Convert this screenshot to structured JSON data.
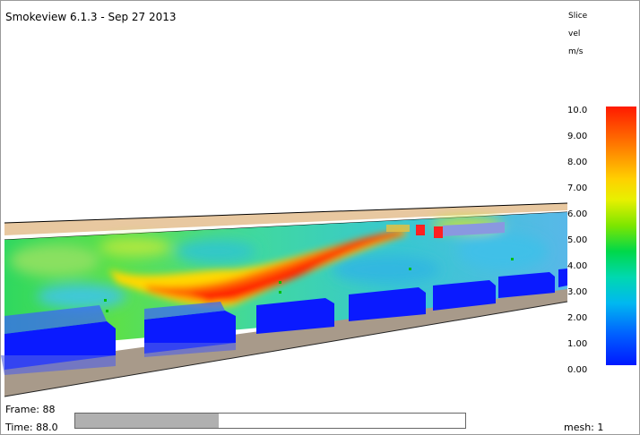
{
  "app": {
    "title": "Smokeview 6.1.3 - Sep 27 2013"
  },
  "colorbar": {
    "slice_label": "Slice",
    "quantity": "vel",
    "unit": "m/s",
    "ticks": [
      "10.0",
      "9.00",
      "8.00",
      "7.00",
      "6.00",
      "5.00",
      "4.00",
      "3.00",
      "2.00",
      "1.00",
      "0.00"
    ],
    "colors": {
      "max": "#ff1a00",
      "mid": "#00d84a",
      "min": "#0018ff"
    }
  },
  "status": {
    "frame_text": "Frame: 88",
    "time_text": "Time: 88.0",
    "mesh_text": "mesh: 1",
    "progress_fraction": 0.367
  },
  "scene": {
    "obstacle_color": "#0a1aff",
    "floor_color": "#a89a8a",
    "ceiling_color": "#e8c8a0"
  }
}
